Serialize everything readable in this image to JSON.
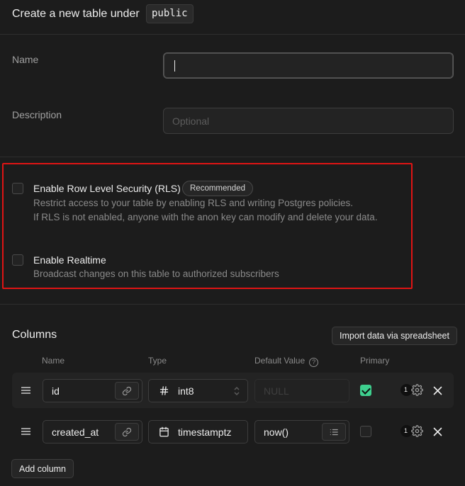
{
  "header": {
    "title": "Create a new table under",
    "schema": "public"
  },
  "form": {
    "name": {
      "label": "Name",
      "value": "",
      "placeholder": ""
    },
    "description": {
      "label": "Description",
      "value": "",
      "placeholder": "Optional"
    }
  },
  "options": {
    "rls": {
      "title": "Enable Row Level Security (RLS)",
      "badge": "Recommended",
      "desc_line1": "Restrict access to your table by enabling RLS and writing Postgres policies.",
      "desc_line2": "If RLS is not enabled, anyone with the anon key can modify and delete your data.",
      "checked": false
    },
    "realtime": {
      "title": "Enable Realtime",
      "desc": "Broadcast changes on this table to authorized subscribers",
      "checked": false
    }
  },
  "columns": {
    "title": "Columns",
    "import_label": "Import data via spreadsheet",
    "headers": {
      "name": "Name",
      "type": "Type",
      "default": "Default Value",
      "primary": "Primary",
      "help": "?"
    },
    "rows": [
      {
        "name": "id",
        "type": "int8",
        "type_icon": "hash-icon",
        "default": "",
        "default_placeholder": "NULL",
        "primary": true,
        "count": "1"
      },
      {
        "name": "created_at",
        "type": "timestamptz",
        "type_icon": "calendar-icon",
        "default": "now()",
        "default_placeholder": "",
        "primary": false,
        "count": "1"
      }
    ],
    "add_label": "Add column"
  },
  "colors": {
    "background": "#1c1c1c",
    "highlight": "#e01414",
    "accent": "#3ecf8e"
  }
}
